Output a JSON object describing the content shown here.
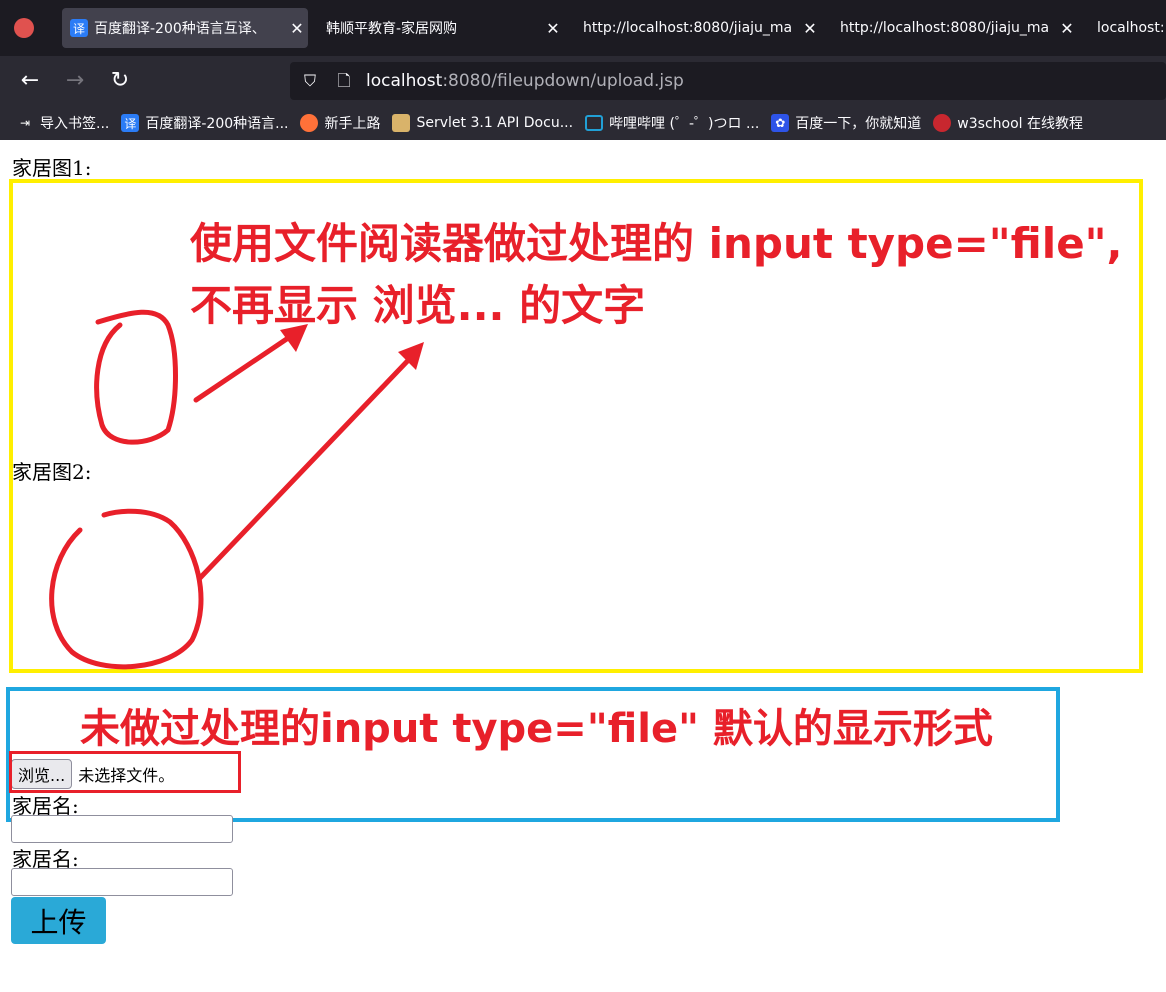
{
  "browser": {
    "tabs": [
      {
        "title": "百度翻译-200种语言互译、",
        "favicon": "译",
        "active": true
      },
      {
        "title": "韩顺平教育-家居网购",
        "active": false
      },
      {
        "title": "http://localhost:8080/jiaju_ma",
        "active": false
      },
      {
        "title": "http://localhost:8080/jiaju_ma",
        "active": false
      },
      {
        "title": "localhost:",
        "active": false
      }
    ],
    "url_host": "localhost",
    "url_rest": ":8080/fileupdown/upload.jsp",
    "bookmarks": [
      {
        "label": "导入书签...",
        "icon": "import-icon"
      },
      {
        "label": "百度翻译-200种语言...",
        "icon": "translate-icon"
      },
      {
        "label": "新手上路",
        "icon": "firefox-icon"
      },
      {
        "label": "Servlet 3.1 API Docu...",
        "icon": "tomcat-icon"
      },
      {
        "label": "哔哩哔哩 (゜-゜)つロ ...",
        "icon": "bilibili-icon"
      },
      {
        "label": "百度一下，你就知道",
        "icon": "baidu-icon"
      },
      {
        "label": "w3school 在线教程",
        "icon": "w3school-icon"
      }
    ]
  },
  "page": {
    "label_img1": "家居图1:",
    "label_img2": "家居图2:",
    "file_button": "浏览...",
    "file_status": "未选择文件。",
    "label_name1": "家居名:",
    "label_name2": "家居名:",
    "upload_button": "上传"
  },
  "annotations": {
    "processed_line1": "使用文件阅读器做过处理的 input type=\"file\",",
    "processed_line2": "不再显示 浏览... 的文字",
    "default_text": "未做过处理的input type=\"file\" 默认的显示形式"
  },
  "colors": {
    "yellow_box": "#ffef00",
    "blue_box": "#1fa7e0",
    "annotation_red": "#e8202a",
    "upload_button": "#2aa9d7"
  }
}
